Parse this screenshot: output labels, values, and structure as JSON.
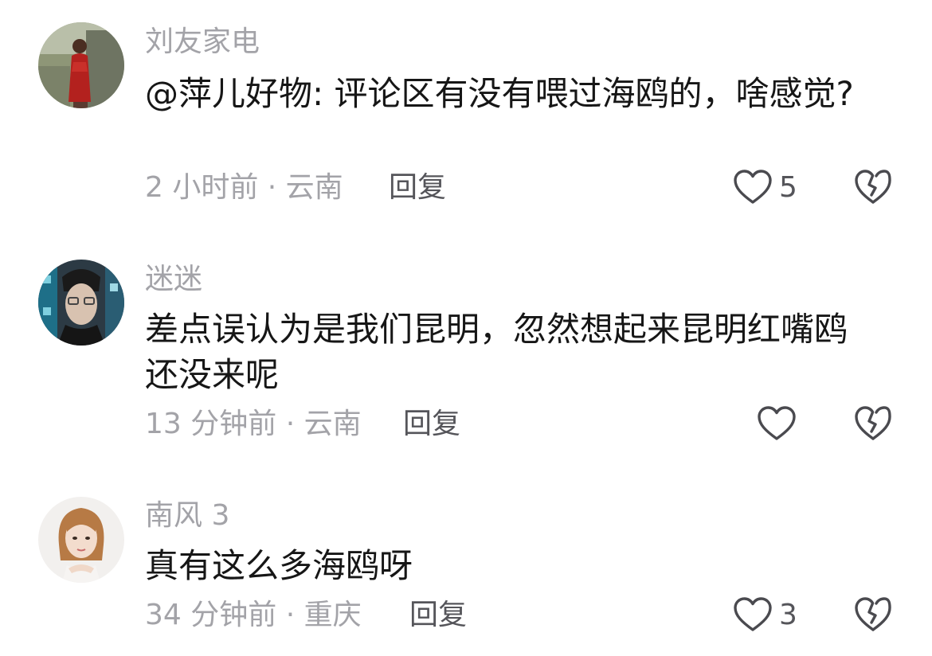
{
  "comments": [
    {
      "username": "刘友家电",
      "text": "@萍儿好物: 评论区有没有喂过海鸥的，啥感觉?",
      "time_location": "2 小时前 · 云南",
      "reply_label": "回复",
      "like_count": "5"
    },
    {
      "username": "迷迷",
      "text": "差点误认为是我们昆明，忽然想起来昆明红嘴鸥还没来呢",
      "time_location": "13 分钟前 · 云南",
      "reply_label": "回复",
      "like_count": ""
    },
    {
      "username": "南风 3",
      "text": "真有这么多海鸥呀",
      "time_location": "34 分钟前 · 重庆",
      "reply_label": "回复",
      "like_count": "3"
    }
  ],
  "icons": {
    "like": "heart-outline-icon",
    "dislike": "broken-heart-icon"
  },
  "colors": {
    "text_primary": "#161616",
    "text_secondary": "#a3a3a8",
    "action_text": "#55555a",
    "icon_stroke": "#4a4a4f"
  }
}
